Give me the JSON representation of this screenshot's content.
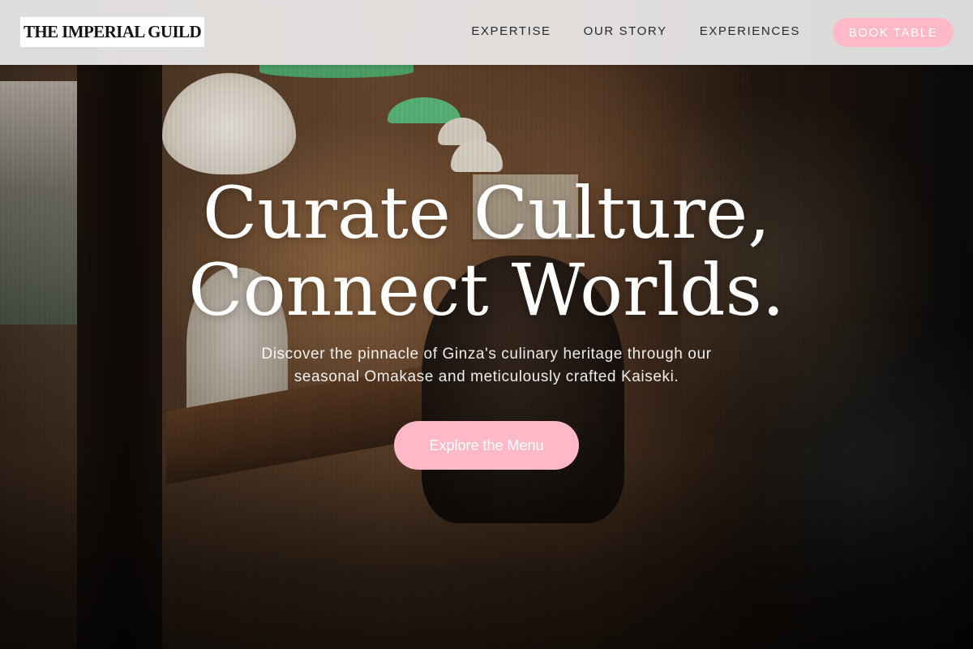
{
  "brand": {
    "logo_text": "THE IMPERIAL GUILD"
  },
  "nav": {
    "links": [
      {
        "label": "EXPERTISE"
      },
      {
        "label": "OUR STORY"
      },
      {
        "label": "EXPERIENCES"
      }
    ],
    "cta_label": "BOOK TABLE"
  },
  "hero": {
    "title_line1": "Curate Culture,",
    "title_line2": "Connect Worlds.",
    "subtitle": "Discover the pinnacle of Ginza's culinary heritage through our seasonal Omakase and meticulously crafted Kaiseki.",
    "cta_label": "Explore the Menu"
  },
  "colors": {
    "accent": "#ffb8c7",
    "header_bg": "#ecebeb",
    "text_dark": "#2a2a2a",
    "text_light": "#ffffff"
  },
  "icons": {
    "hero_background": "izakaya-photo"
  }
}
